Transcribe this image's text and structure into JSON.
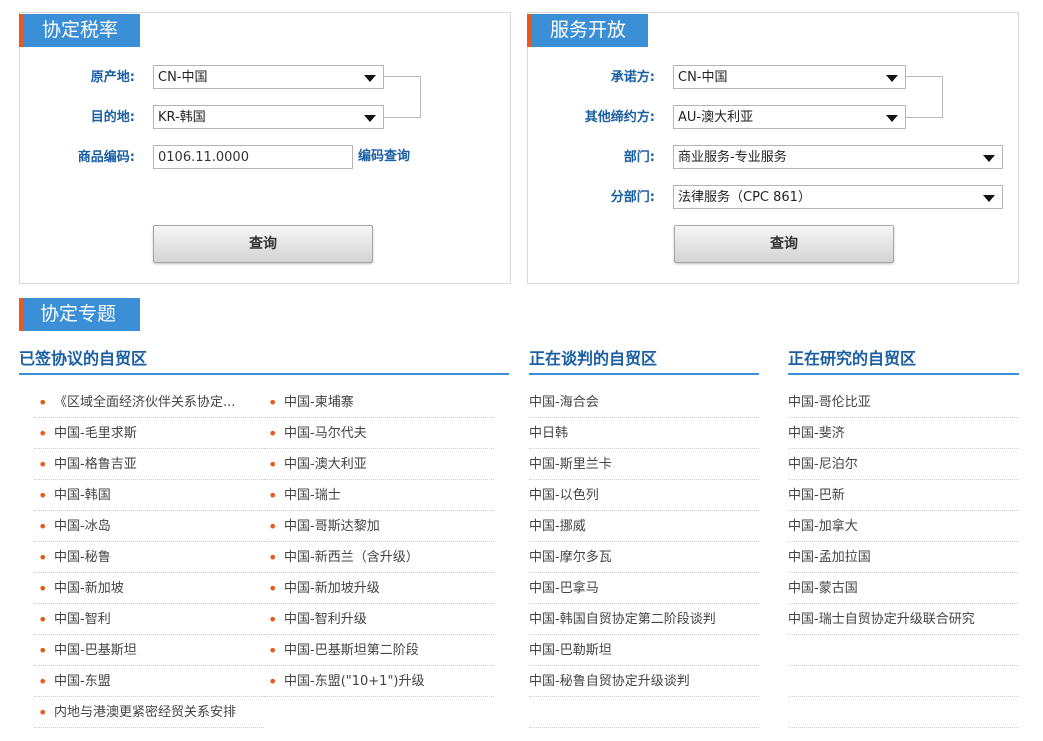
{
  "tariff_panel": {
    "title": "协定税率",
    "origin_label": "原产地:",
    "origin_value": "CN-中国",
    "dest_label": "目的地:",
    "dest_value": "KR-韩国",
    "code_label": "商品编码:",
    "code_value": "0106.11.0000",
    "code_link": "编码查询",
    "query_button": "查询"
  },
  "service_panel": {
    "title": "服务开放",
    "committer_label": "承诺方:",
    "committer_value": "CN-中国",
    "other_label": "其他缔约方:",
    "other_value": "AU-澳大利亚",
    "dept_label": "部门:",
    "dept_value": "商业服务-专业服务",
    "subdept_label": "分部门:",
    "subdept_value": "法律服务（CPC 861）",
    "query_button": "查询"
  },
  "topics": {
    "title": "协定专题",
    "signed": {
      "heading": "已签协议的自贸区",
      "col1": [
        "《区域全面经济伙伴关系协定...",
        "中国-毛里求斯",
        "中国-格鲁吉亚",
        "中国-韩国",
        "中国-冰岛",
        "中国-秘鲁",
        "中国-新加坡",
        "中国-智利",
        "中国-巴基斯坦",
        "中国-东盟",
        "内地与港澳更紧密经贸关系安排"
      ],
      "col2": [
        "中国-柬埔寨",
        "中国-马尔代夫",
        "中国-澳大利亚",
        "中国-瑞士",
        "中国-哥斯达黎加",
        "中国-新西兰（含升级）",
        "中国-新加坡升级",
        "中国-智利升级",
        "中国-巴基斯坦第二阶段",
        "中国-东盟(\"10+1\")升级"
      ]
    },
    "negotiating": {
      "heading": "正在谈判的自贸区",
      "items": [
        "中国-海合会",
        "中日韩",
        "中国-斯里兰卡",
        "中国-以色列",
        "中国-挪威",
        "中国-摩尔多瓦",
        "中国-巴拿马",
        "中国-韩国自贸协定第二阶段谈判",
        "中国-巴勒斯坦",
        "中国-秘鲁自贸协定升级谈判"
      ]
    },
    "researching": {
      "heading": "正在研究的自贸区",
      "items": [
        "中国-哥伦比亚",
        "中国-斐济",
        "中国-尼泊尔",
        "中国-巴新",
        "中国-加拿大",
        "中国-孟加拉国",
        "中国-蒙古国",
        "中国-瑞士自贸协定升级联合研究"
      ]
    }
  },
  "colors": {
    "accent_blue": "#3b8fd6",
    "accent_orange": "#e85a1a",
    "label_blue": "#1a5fa3"
  }
}
